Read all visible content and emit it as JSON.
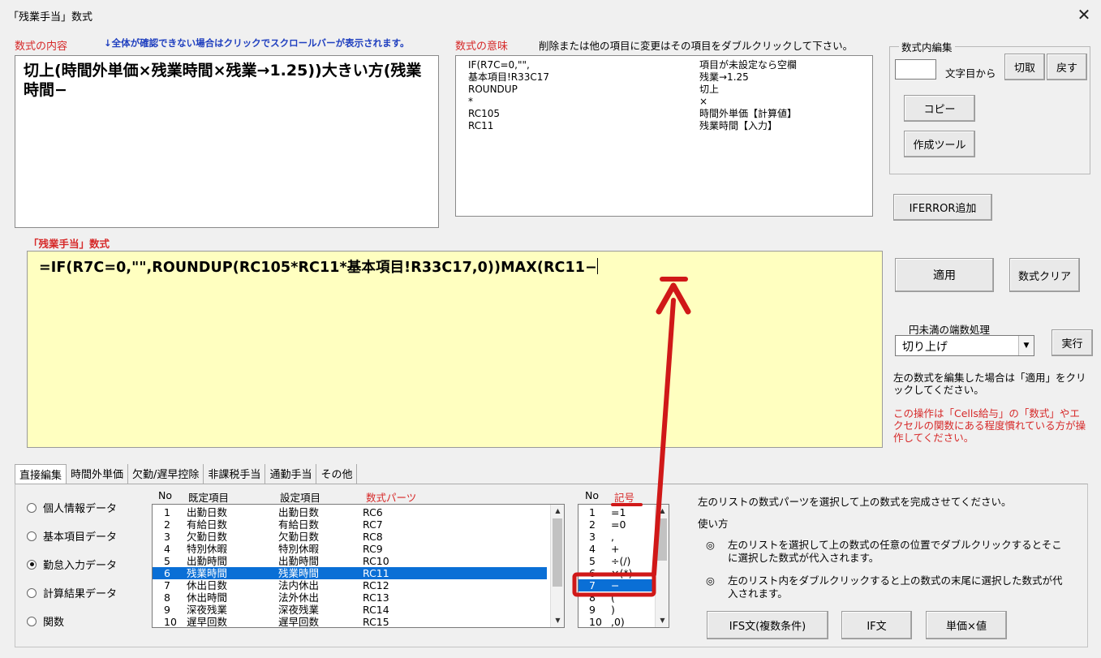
{
  "window": {
    "title": "「残業手当」数式",
    "close_label": "✕"
  },
  "formula_content": {
    "label": "数式の内容",
    "note": "↓全体が確認できない場合はクリックでスクロールバーが表示されます。",
    "text": "切上(時間外単価×残業時間×残業→1.25))大きい方(残業時間−"
  },
  "formula_meaning": {
    "label": "数式の意味",
    "note": "削除または他の項目に変更はその項目をダブルクリックして下さい。",
    "rows": [
      {
        "code": "IF(R7C=0,\"\",",
        "meaning": "項目が未設定なら空欄"
      },
      {
        "code": "基本項目!R33C17",
        "meaning": "残業→1.25"
      },
      {
        "code": "ROUNDUP",
        "meaning": "切上"
      },
      {
        "code": "*",
        "meaning": "×"
      },
      {
        "code": "RC105",
        "meaning": "時間外単価【計算値】"
      },
      {
        "code": "RC11",
        "meaning": "残業時間【入力】"
      }
    ]
  },
  "edit_group": {
    "title": "数式内編集",
    "position_value": "",
    "position_suffix": "文字目から",
    "cut_label": "切取",
    "undo_label": "戻す",
    "copy_label": "コピー",
    "tool_label": "作成ツール"
  },
  "iferror_label": "IFERROR追加",
  "formula_editor": {
    "label": "「残業手当」数式",
    "text": "=IF(R7C=0,\"\",ROUNDUP(RC105*RC11*基本項目!R33C17,0))MAX(RC11−"
  },
  "apply_label": "適用",
  "clear_label": "数式クリア",
  "rounding": {
    "label": "円未満の端数処理",
    "selected": "切り上げ",
    "run_label": "実行"
  },
  "notes": {
    "apply_note": "左の数式を編集した場合は「適用」をクリックしてください。",
    "warning": "この操作は「Cells給与」の「数式」やエクセルの関数にある程度慣れている方が操作してください。"
  },
  "tabs": [
    "直接編集",
    "時間外単価",
    "欠勤/遅早控除",
    "非課税手当",
    "通勤手当",
    "その他"
  ],
  "radios": [
    {
      "label": "個人情報データ",
      "checked": false
    },
    {
      "label": "基本項目データ",
      "checked": false
    },
    {
      "label": "勤怠入力データ",
      "checked": true
    },
    {
      "label": "計算結果データ",
      "checked": false
    },
    {
      "label": "関数",
      "checked": false
    }
  ],
  "parts_list": {
    "headers": {
      "no": "No",
      "default": "既定項目",
      "setting": "設定項目",
      "part": "数式パーツ"
    },
    "rows": [
      {
        "no": "1",
        "default": "出勤日数",
        "setting": "出勤日数",
        "part": "RC6"
      },
      {
        "no": "2",
        "default": "有給日数",
        "setting": "有給日数",
        "part": "RC7"
      },
      {
        "no": "3",
        "default": "欠勤日数",
        "setting": "欠勤日数",
        "part": "RC8"
      },
      {
        "no": "4",
        "default": "特別休暇",
        "setting": "特別休暇",
        "part": "RC9"
      },
      {
        "no": "5",
        "default": "出勤時間",
        "setting": "出勤時間",
        "part": "RC10"
      },
      {
        "no": "6",
        "default": "残業時間",
        "setting": "残業時間",
        "part": "RC11",
        "selected": true
      },
      {
        "no": "7",
        "default": "休出日数",
        "setting": "法内休出",
        "part": "RC12"
      },
      {
        "no": "8",
        "default": "休出時間",
        "setting": "法外休出",
        "part": "RC13"
      },
      {
        "no": "9",
        "default": "深夜残業",
        "setting": "深夜残業",
        "part": "RC14"
      },
      {
        "no": "10",
        "default": "遅早回数",
        "setting": "遅早回数",
        "part": "RC15"
      }
    ]
  },
  "symbol_list": {
    "headers": {
      "no": "No",
      "symbol": "記号"
    },
    "rows": [
      {
        "no": "1",
        "sym": "=1"
      },
      {
        "no": "2",
        "sym": "=0"
      },
      {
        "no": "3",
        "sym": ","
      },
      {
        "no": "4",
        "sym": "+"
      },
      {
        "no": "5",
        "sym": "÷(/)"
      },
      {
        "no": "6",
        "sym": "×(*)"
      },
      {
        "no": "7",
        "sym": "−",
        "selected": true
      },
      {
        "no": "8",
        "sym": "("
      },
      {
        "no": "9",
        "sym": ")"
      },
      {
        "no": "10",
        "sym": ",0)"
      }
    ]
  },
  "help": {
    "intro": "左のリストの数式パーツを選択して上の数式を完成させてください。",
    "usage_title": "使い方",
    "item1_mark": "◎",
    "item1": "左のリストを選択して上の数式の任意の位置でダブルクリックするとそこに選択した数式が代入されます。",
    "item2_mark": "◎",
    "item2": "左のリスト内をダブルクリックすると上の数式の末尾に選択した数式が代入されます。"
  },
  "bottom_buttons": {
    "ifs_label": "IFS文(複数条件)",
    "if_label": "IF文",
    "unit_label": "単価×値"
  },
  "colors": {
    "annotation": "#d01818",
    "selection": "#0a6fd6",
    "editor_bg": "#ffffc0"
  }
}
